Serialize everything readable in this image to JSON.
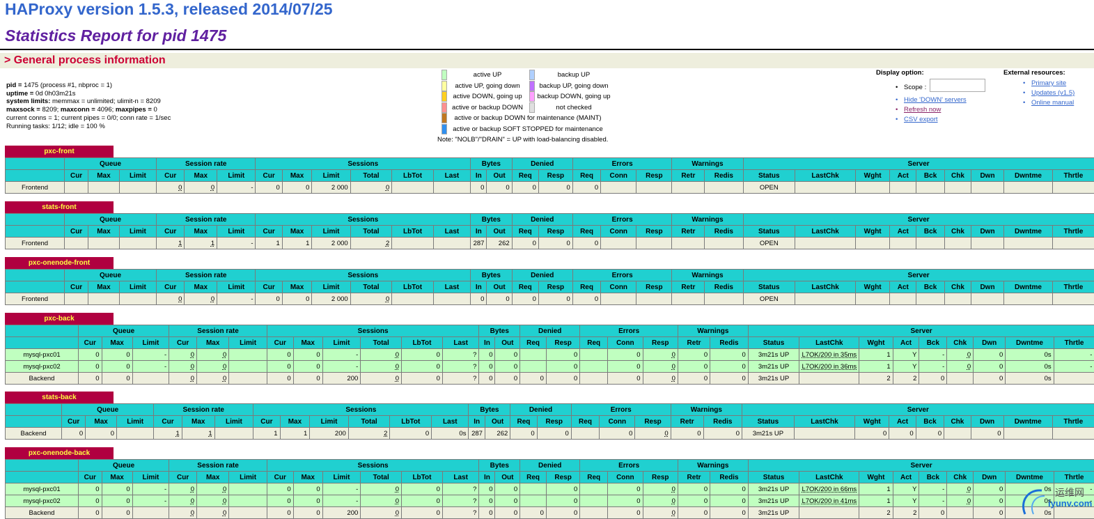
{
  "header": {
    "title": "HAProxy version 1.5.3, released 2014/07/25",
    "subtitle": "Statistics Report for pid 1475",
    "section": "> General process information"
  },
  "process_info": [
    {
      "b": "pid = ",
      "t": "1475 (process #1, nbproc = 1)"
    },
    {
      "b": "uptime = ",
      "t": "0d 0h03m21s"
    },
    {
      "b": "system limits:",
      "t": " memmax = unlimited; ulimit-n = 8209"
    },
    {
      "b": "maxsock = ",
      "t": "8209; "
    },
    {
      "b": "",
      "t": "current conns = 1; current pipes = 0/0; conn rate = 1/sec"
    },
    {
      "b": "",
      "t": "Running tasks: 1/12; idle = 100 %"
    }
  ],
  "process_info_line4": {
    "b2": "maxconn = ",
    "t2": "4096; ",
    "b3": "maxpipes = ",
    "t3": "0"
  },
  "legend": {
    "items_left": [
      {
        "label": "active UP",
        "color": "#c0ffc0"
      },
      {
        "label": "active UP, going down",
        "color": "#ffffa0"
      },
      {
        "label": "active DOWN, going up",
        "color": "#ffd020"
      },
      {
        "label": "active or backup DOWN",
        "color": "#ff9090"
      }
    ],
    "items_right": [
      {
        "label": "backup UP",
        "color": "#b0d0ff"
      },
      {
        "label": "backup UP, going down",
        "color": "#c070ff"
      },
      {
        "label": "backup DOWN, going up",
        "color": "#ffa0ff"
      },
      {
        "label": "not checked",
        "color": "#e0e0e0"
      }
    ],
    "maint": {
      "label": "active or backup DOWN for maintenance (MAINT)",
      "color": "#c07820"
    },
    "soft": {
      "label": "active or backup SOFT STOPPED for maintenance",
      "color": "#3090f0"
    },
    "note": "Note: \"NOLB\"/\"DRAIN\" = UP with load-balancing disabled."
  },
  "display_option": {
    "title": "Display option:",
    "scope_label": "Scope :",
    "scope_value": "",
    "links": [
      "Hide 'DOWN' servers",
      "Refresh now",
      "CSV export"
    ]
  },
  "external": {
    "title": "External resources:",
    "links": [
      "Primary site",
      "Updates (v1.5)",
      "Online manual"
    ]
  },
  "groups": [
    "",
    "Queue",
    "Session rate",
    "Sessions",
    "Bytes",
    "Denied",
    "Errors",
    "Warnings",
    "Server"
  ],
  "columns": [
    "",
    "Cur",
    "Max",
    "Limit",
    "Cur",
    "Max",
    "Limit",
    "Cur",
    "Max",
    "Limit",
    "Total",
    "LbTot",
    "Last",
    "In",
    "Out",
    "Req",
    "Resp",
    "Req",
    "Conn",
    "Resp",
    "Retr",
    "Redis",
    "Status",
    "LastChk",
    "Wght",
    "Act",
    "Bck",
    "Chk",
    "Dwn",
    "Dwntme",
    "Thrtle"
  ],
  "proxies": [
    {
      "name": "pxc-front",
      "rows": [
        {
          "type": "fe",
          "cells": [
            "Frontend",
            "",
            "",
            "",
            "0",
            "0",
            "-",
            "0",
            "0",
            "2 000",
            "0",
            "",
            "",
            "0",
            "0",
            "0",
            "0",
            "0",
            "",
            "",
            "",
            "",
            "OPEN",
            "",
            "",
            "",
            "",
            "",
            "",
            "",
            ""
          ]
        }
      ]
    },
    {
      "name": "stats-front",
      "rows": [
        {
          "type": "fe",
          "cells": [
            "Frontend",
            "",
            "",
            "",
            "1",
            "1",
            "-",
            "1",
            "1",
            "2 000",
            "2",
            "",
            "",
            "287",
            "262",
            "0",
            "0",
            "0",
            "",
            "",
            "",
            "",
            "OPEN",
            "",
            "",
            "",
            "",
            "",
            "",
            "",
            ""
          ]
        }
      ]
    },
    {
      "name": "pxc-onenode-front",
      "rows": [
        {
          "type": "fe",
          "cells": [
            "Frontend",
            "",
            "",
            "",
            "0",
            "0",
            "-",
            "0",
            "0",
            "2 000",
            "0",
            "",
            "",
            "0",
            "0",
            "0",
            "0",
            "0",
            "",
            "",
            "",
            "",
            "OPEN",
            "",
            "",
            "",
            "",
            "",
            "",
            "",
            ""
          ]
        }
      ]
    },
    {
      "name": "pxc-back",
      "rows": [
        {
          "type": "up",
          "cells": [
            "mysql-pxc01",
            "0",
            "0",
            "-",
            "0",
            "0",
            "",
            "0",
            "0",
            "-",
            "0",
            "0",
            "?",
            "0",
            "0",
            "",
            "0",
            "",
            "0",
            "0",
            "0",
            "0",
            "3m21s UP",
            "L7OK/200 in 35ms",
            "1",
            "Y",
            "-",
            "0",
            "0",
            "0s",
            "-"
          ]
        },
        {
          "type": "up",
          "cells": [
            "mysql-pxc02",
            "0",
            "0",
            "-",
            "0",
            "0",
            "",
            "0",
            "0",
            "-",
            "0",
            "0",
            "?",
            "0",
            "0",
            "",
            "0",
            "",
            "0",
            "0",
            "0",
            "0",
            "3m21s UP",
            "L7OK/200 in 36ms",
            "1",
            "Y",
            "-",
            "0",
            "0",
            "0s",
            "-"
          ]
        },
        {
          "type": "be",
          "cells": [
            "Backend",
            "0",
            "0",
            "",
            "0",
            "0",
            "",
            "0",
            "0",
            "200",
            "0",
            "0",
            "?",
            "0",
            "0",
            "0",
            "0",
            "",
            "0",
            "0",
            "0",
            "0",
            "3m21s UP",
            "",
            "2",
            "2",
            "0",
            "",
            "0",
            "0s",
            ""
          ]
        }
      ]
    },
    {
      "name": "stats-back",
      "rows": [
        {
          "type": "be",
          "cells": [
            "Backend",
            "0",
            "0",
            "",
            "1",
            "1",
            "",
            "1",
            "1",
            "200",
            "2",
            "0",
            "0s",
            "287",
            "262",
            "0",
            "0",
            "",
            "0",
            "0",
            "0",
            "0",
            "3m21s UP",
            "",
            "0",
            "0",
            "0",
            "",
            "0",
            "",
            ""
          ]
        }
      ]
    },
    {
      "name": "pxc-onenode-back",
      "rows": [
        {
          "type": "up",
          "cells": [
            "mysql-pxc01",
            "0",
            "0",
            "-",
            "0",
            "0",
            "",
            "0",
            "0",
            "-",
            "0",
            "0",
            "?",
            "0",
            "0",
            "",
            "0",
            "",
            "0",
            "0",
            "0",
            "0",
            "3m21s UP",
            "L7OK/200 in 66ms",
            "1",
            "Y",
            "-",
            "0",
            "0",
            "0s",
            "-"
          ]
        },
        {
          "type": "up",
          "cells": [
            "mysql-pxc02",
            "0",
            "0",
            "-",
            "0",
            "0",
            "",
            "0",
            "0",
            "-",
            "0",
            "0",
            "?",
            "0",
            "0",
            "",
            "0",
            "",
            "0",
            "0",
            "0",
            "0",
            "3m21s UP",
            "L7OK/200 in 41ms",
            "1",
            "Y",
            "-",
            "0",
            "0",
            "0s",
            "-"
          ]
        },
        {
          "type": "be",
          "cells": [
            "Backend",
            "0",
            "0",
            "",
            "0",
            "0",
            "",
            "0",
            "0",
            "200",
            "0",
            "0",
            "?",
            "0",
            "0",
            "0",
            "0",
            "",
            "0",
            "0",
            "0",
            "0",
            "3m21s UP",
            "",
            "2",
            "2",
            "0",
            "",
            "0",
            "0s",
            ""
          ]
        }
      ]
    }
  ],
  "watermark": {
    "cn": "运维网",
    "en": "iyunv.com"
  }
}
